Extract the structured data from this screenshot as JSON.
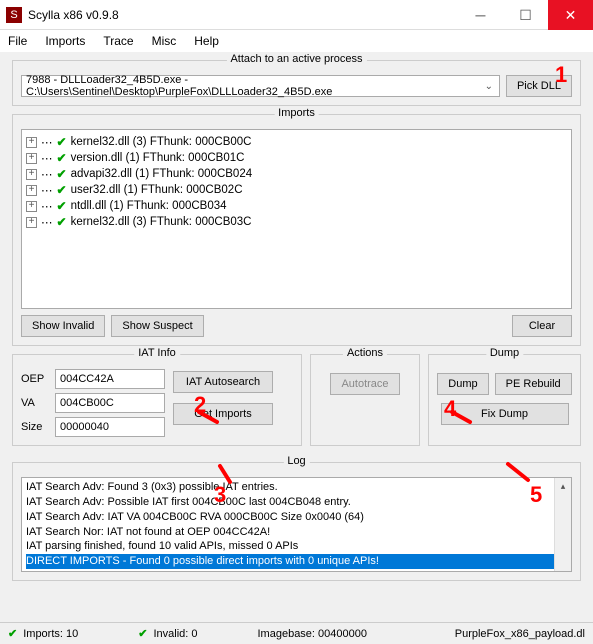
{
  "window": {
    "title": "Scylla x86 v0.9.8",
    "icon_letter": "S"
  },
  "menu": [
    "File",
    "Imports",
    "Trace",
    "Misc",
    "Help"
  ],
  "attach": {
    "title": "Attach to an active process",
    "process_value": "7988 - DLLLoader32_4B5D.exe - C:\\Users\\Sentinel\\Desktop\\PurpleFox\\DLLLoader32_4B5D.exe",
    "pick_dll": "Pick DLL"
  },
  "imports": {
    "title": "Imports",
    "items": [
      "kernel32.dll (3) FThunk: 000CB00C",
      "version.dll (1) FThunk: 000CB01C",
      "advapi32.dll (1) FThunk: 000CB024",
      "user32.dll (1) FThunk: 000CB02C",
      "ntdll.dll (1) FThunk: 000CB034",
      "kernel32.dll (3) FThunk: 000CB03C"
    ],
    "show_invalid": "Show Invalid",
    "show_suspect": "Show Suspect",
    "clear": "Clear"
  },
  "iat": {
    "title": "IAT Info",
    "oep_label": "OEP",
    "oep_value": "004CC42A",
    "va_label": "VA",
    "va_value": "004CB00C",
    "size_label": "Size",
    "size_value": "00000040",
    "autosearch": "IAT Autosearch",
    "get_imports": "Get Imports"
  },
  "actions": {
    "title": "Actions",
    "autotrace": "Autotrace"
  },
  "dump": {
    "title": "Dump",
    "dump_btn": "Dump",
    "pe_rebuild": "PE Rebuild",
    "fix_dump": "Fix Dump"
  },
  "log": {
    "title": "Log",
    "lines": [
      "IAT Search Adv: Found 3 (0x3) possible IAT entries.",
      "IAT Search Adv: Possible IAT first 004CB00C last 004CB048 entry.",
      "IAT Search Adv: IAT VA 004CB00C RVA 000CB00C Size 0x0040 (64)",
      "IAT Search Nor: IAT not found at OEP 004CC42A!",
      "IAT parsing finished, found 10 valid APIs, missed 0 APIs",
      "DIRECT IMPORTS - Found 0 possible direct imports with 0 unique APIs!"
    ]
  },
  "status": {
    "imports": "Imports: 10",
    "invalid": "Invalid: 0",
    "imagebase": "Imagebase: 00400000",
    "filename": "PurpleFox_x86_payload.dl"
  },
  "annotations": {
    "n1": "1",
    "n2": "2",
    "n3": "3",
    "n4": "4",
    "n5": "5"
  }
}
